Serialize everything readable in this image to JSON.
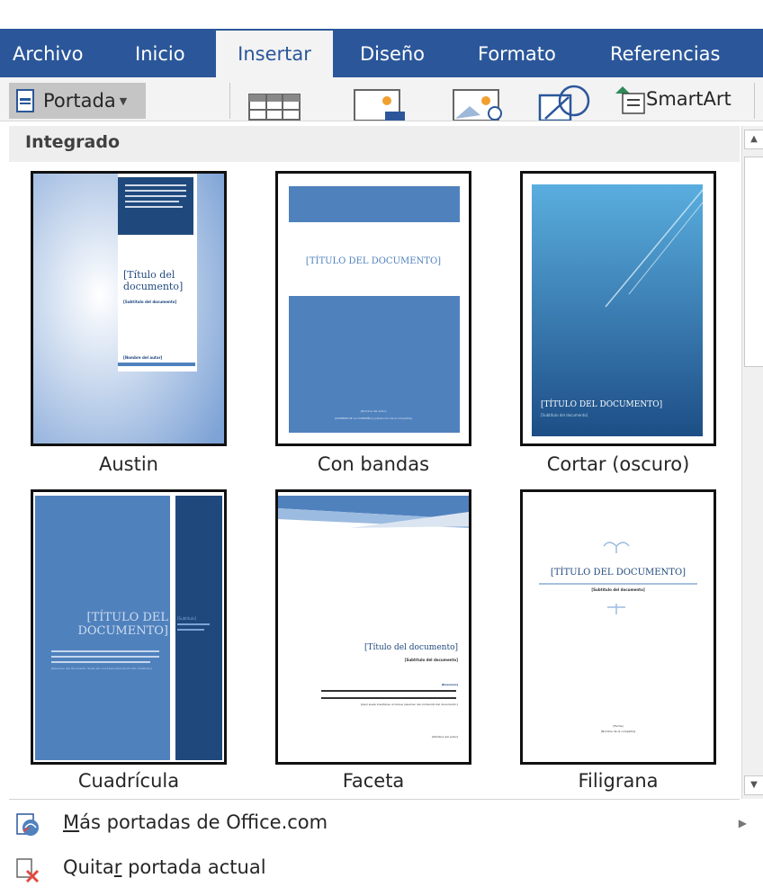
{
  "ribbon": {
    "tabs": [
      {
        "label": "Archivo"
      },
      {
        "label": "Inicio"
      },
      {
        "label": "Insertar",
        "active": true
      },
      {
        "label": "Diseño"
      },
      {
        "label": "Formato"
      },
      {
        "label": "Referencias"
      }
    ]
  },
  "toolbar": {
    "portada_label": "Portada",
    "smartart_label": "SmartArt"
  },
  "gallery": {
    "section_title": "Integrado",
    "items": [
      {
        "caption": "Austin",
        "title": "[Título del documento]",
        "subtitle": "[Subtítulo del documento]",
        "author": "[Nombre del autor]",
        "abstract": "[Resumen del documento. Suele ser una breve descripción del contenido del documento.]"
      },
      {
        "caption": "Con bandas",
        "title": "[TÍTULO DEL DOCUMENTO]",
        "line1": "[Nombre del autor]",
        "line2": "[NOMBRE DE LA COMPAÑÍA] | [Dirección de la compañía]"
      },
      {
        "caption": "Cortar (oscuro)",
        "title": "[TÍTULO DEL DOCUMENTO]",
        "subtitle": "[Subtítulo del documento]"
      },
      {
        "caption": "Cuadrícula",
        "title_line1": "[TÍTULO DEL",
        "title_line2": "DOCUMENTO]",
        "subtitle": "[Subtítulo]",
        "abstract": "[Resumen del documento. Suele ser una breve descripción del contenido.]"
      },
      {
        "caption": "Faceta",
        "title": "[Título del documento]",
        "subtitle": "[Subtítulo del documento]",
        "abstract_head": "[Resumen]",
        "abstract": "[Aquí suele insertarse un breve resumen del contenido del documento.]",
        "author": "[Nombre del autor]"
      },
      {
        "caption": "Filigrana",
        "title": "[TÍTULO DEL DOCUMENTO]",
        "subtitle": "[Subtítulo del documento]",
        "date": "[Fecha]",
        "company": "[Nombre de la compañía]"
      }
    ]
  },
  "menu": {
    "more_prefix": "",
    "more_underlined": "M",
    "more_rest": "ás portadas de Office.com",
    "remove_prefix": "Quita",
    "remove_underlined": "r",
    "remove_rest": " portada actual"
  },
  "colors": {
    "ribbon_blue": "#2b579a",
    "cover_blue": "#4f81bd",
    "cover_dark": "#1f497d"
  }
}
